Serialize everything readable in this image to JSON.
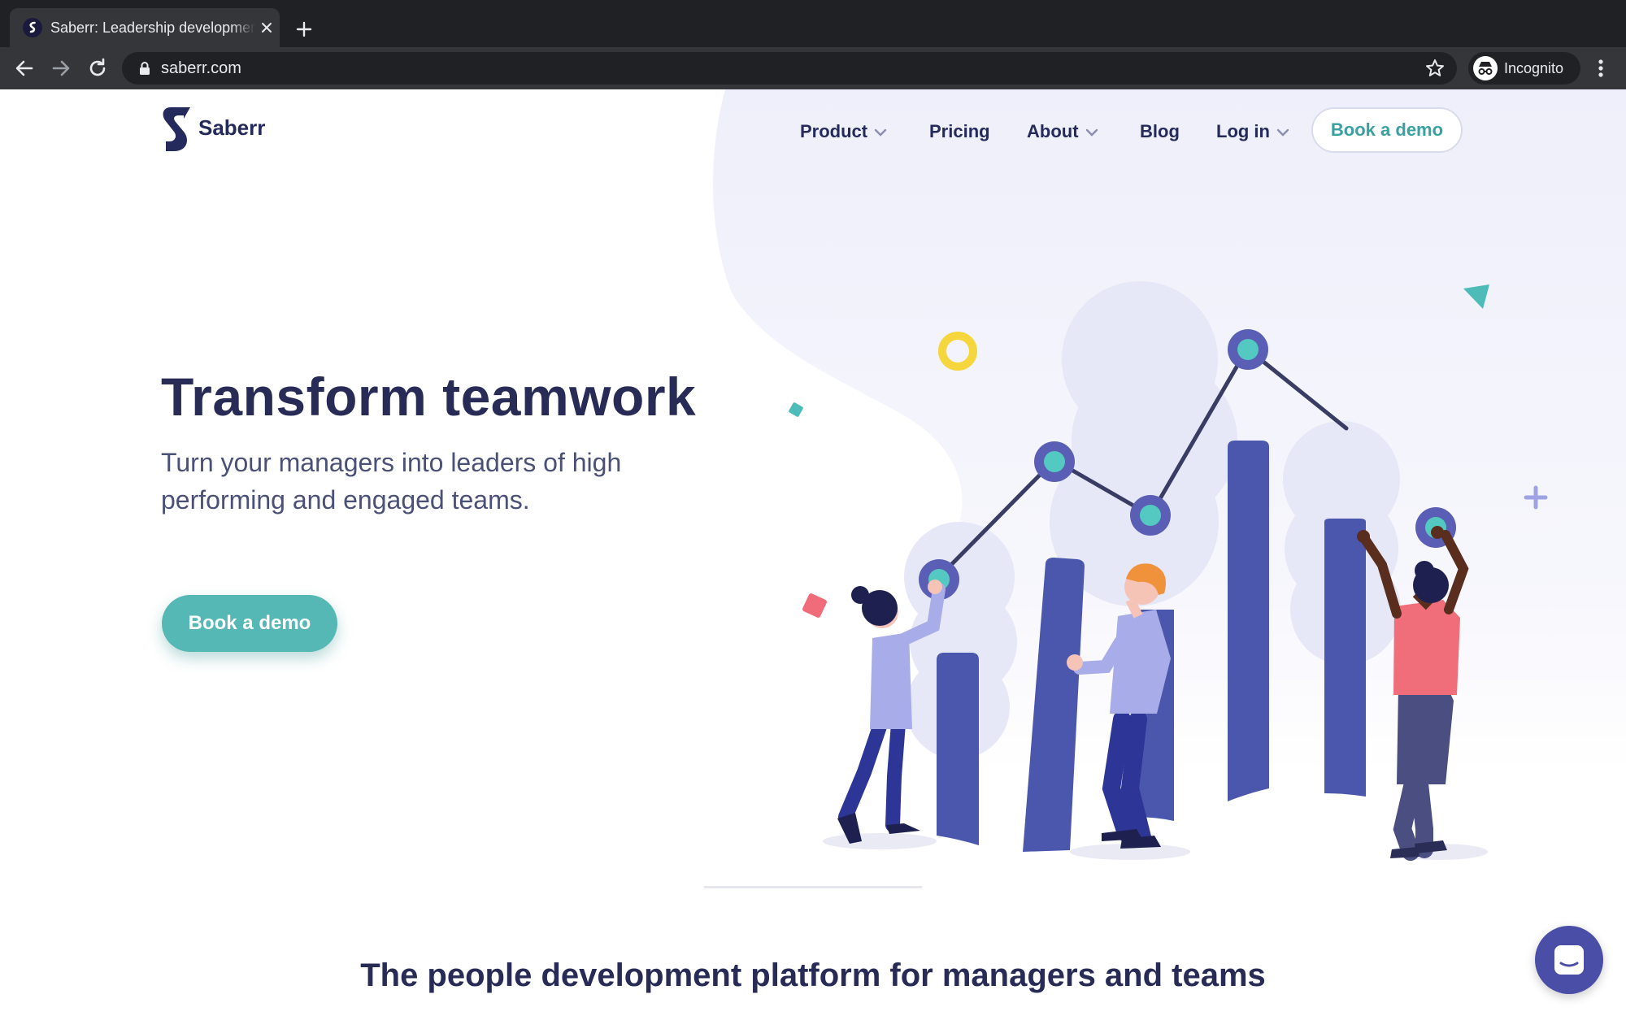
{
  "browser": {
    "tab_title": "Saberr: Leadership development",
    "url": "saberr.com",
    "profile_label": "Incognito"
  },
  "site": {
    "logo_text": "Saberr",
    "nav": [
      {
        "label": "Product",
        "dropdown": true
      },
      {
        "label": "Pricing",
        "dropdown": false
      },
      {
        "label": "About",
        "dropdown": true
      },
      {
        "label": "Blog",
        "dropdown": false
      },
      {
        "label": "Log in",
        "dropdown": true
      }
    ],
    "nav_cta": "Book a demo"
  },
  "hero": {
    "title": "Transform teamwork",
    "subtitle": "Turn your managers into leaders of high performing and engaged teams.",
    "cta": "Book a demo"
  },
  "section": {
    "title": "The people development platform for managers and teams"
  },
  "colors": {
    "primary_text": "#282b56",
    "accent_teal": "#56b8b5",
    "illustration_bar": "#4b57ad",
    "background_blob": "#f1f1fb"
  },
  "icons": [
    "back-icon",
    "forward-icon",
    "reload-icon",
    "lock-icon",
    "star-icon",
    "incognito-icon",
    "menu-icon",
    "chat-icon",
    "chevron-down-icon"
  ]
}
